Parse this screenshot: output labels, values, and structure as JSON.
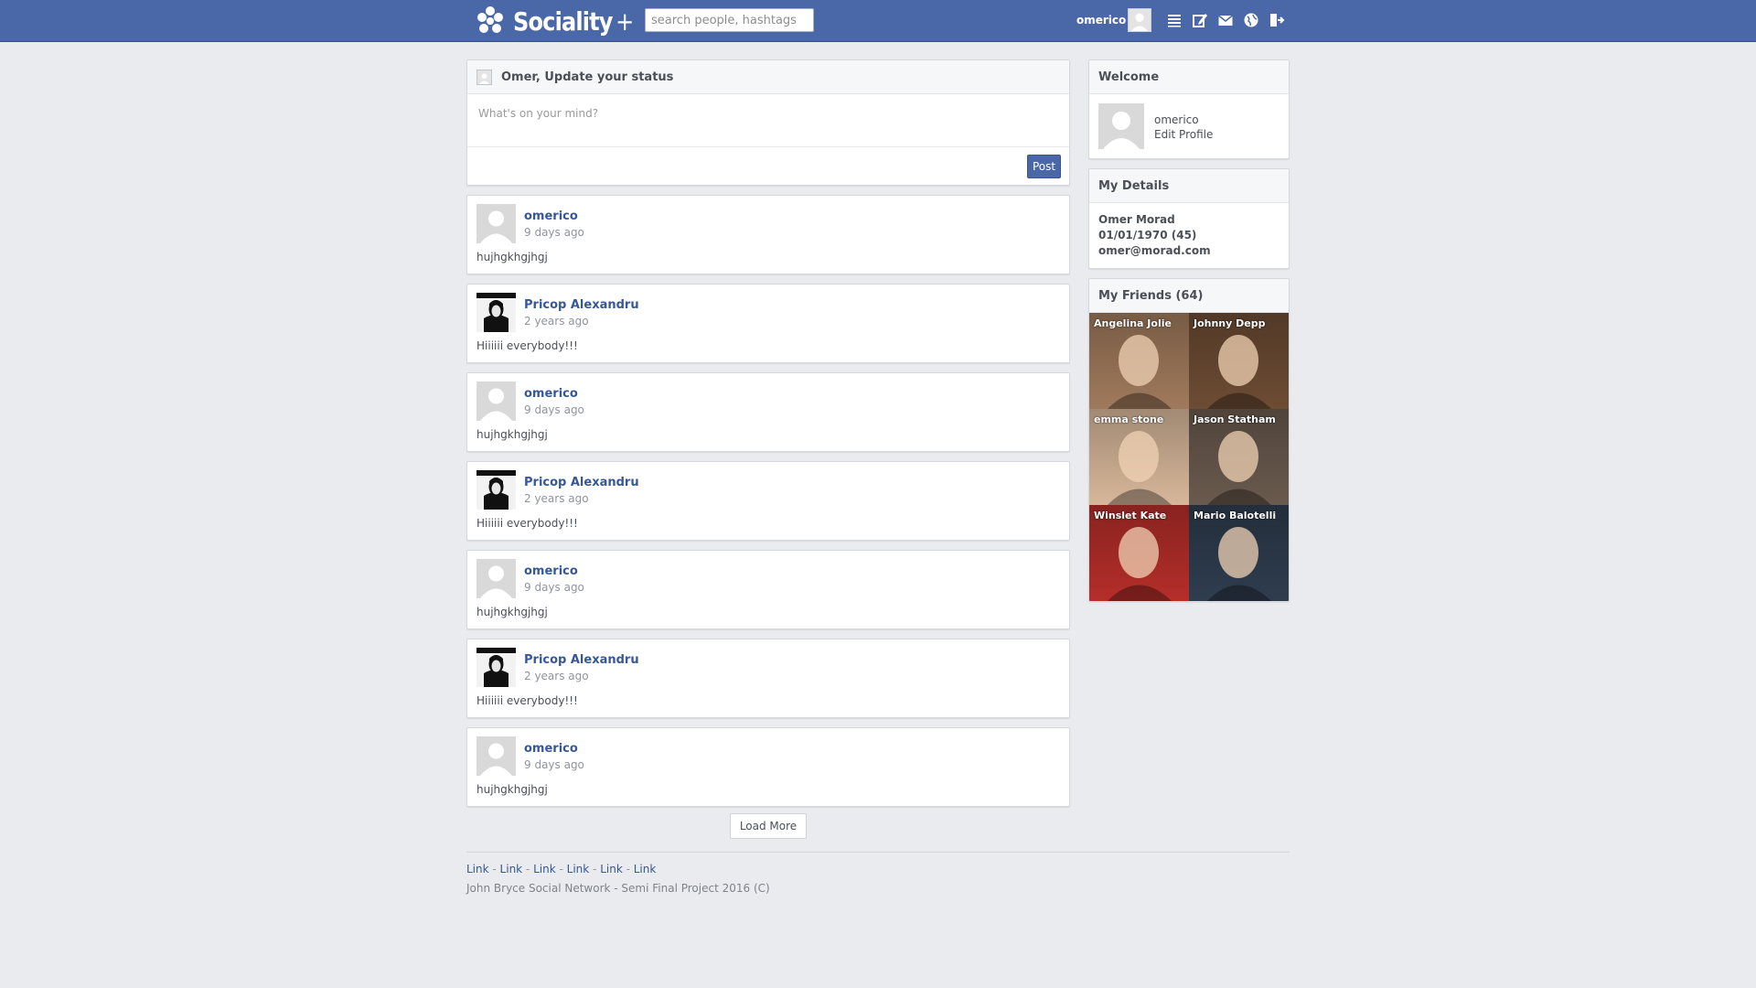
{
  "brand": {
    "name": "Sociality",
    "plus": "+"
  },
  "search": {
    "placeholder": "search people, hashtags",
    "value": ""
  },
  "nav": {
    "username": "omerico",
    "icons": [
      "list-icon",
      "edit-icon",
      "mail-icon",
      "globe-icon",
      "logout-icon"
    ]
  },
  "composer": {
    "title": "Omer, Update your status",
    "placeholder": "What's on your mind?",
    "post_label": "Post"
  },
  "posts": [
    {
      "author": "omerico",
      "time": "9 days ago",
      "body": "hujhgkhgjhgj",
      "avatar": "default"
    },
    {
      "author": "Pricop Alexandru",
      "time": "2 years ago",
      "body": "Hiiiiii everybody!!!",
      "avatar": "photo"
    },
    {
      "author": "omerico",
      "time": "9 days ago",
      "body": "hujhgkhgjhgj",
      "avatar": "default"
    },
    {
      "author": "Pricop Alexandru",
      "time": "2 years ago",
      "body": "Hiiiiii everybody!!!",
      "avatar": "photo"
    },
    {
      "author": "omerico",
      "time": "9 days ago",
      "body": "hujhgkhgjhgj",
      "avatar": "default"
    },
    {
      "author": "Pricop Alexandru",
      "time": "2 years ago",
      "body": "Hiiiiii everybody!!!",
      "avatar": "photo"
    },
    {
      "author": "omerico",
      "time": "9 days ago",
      "body": "hujhgkhgjhgj",
      "avatar": "default"
    }
  ],
  "load_more_label": "Load More",
  "footer": {
    "links": [
      "Link",
      "Link",
      "Link",
      "Link",
      "Link",
      "Link"
    ],
    "separator": " - ",
    "copyright": "John Bryce Social Network - Semi Final Project 2016 (C)"
  },
  "welcome": {
    "title": "Welcome",
    "username": "omerico",
    "edit_label": "Edit Profile"
  },
  "details": {
    "title": "My Details",
    "name": "Omer Morad",
    "dob": "01/01/1970 (45)",
    "email": "omer@morad.com"
  },
  "friends": {
    "title": "My Friends (64)",
    "list": [
      {
        "name": "Angelina Jolie",
        "tone": "#a07a5c"
      },
      {
        "name": "Johnny Depp",
        "tone": "#6d4c34"
      },
      {
        "name": "emma stone",
        "tone": "#d7b79a"
      },
      {
        "name": "Jason Statham",
        "tone": "#6a5a4e"
      },
      {
        "name": "Winslet Kate",
        "tone": "#b52e2a"
      },
      {
        "name": "Mario Balotelli",
        "tone": "#2f3d4f"
      }
    ]
  },
  "colors": {
    "brand": "#4a67a8",
    "link": "#365899",
    "page_bg": "#e9ebee"
  }
}
